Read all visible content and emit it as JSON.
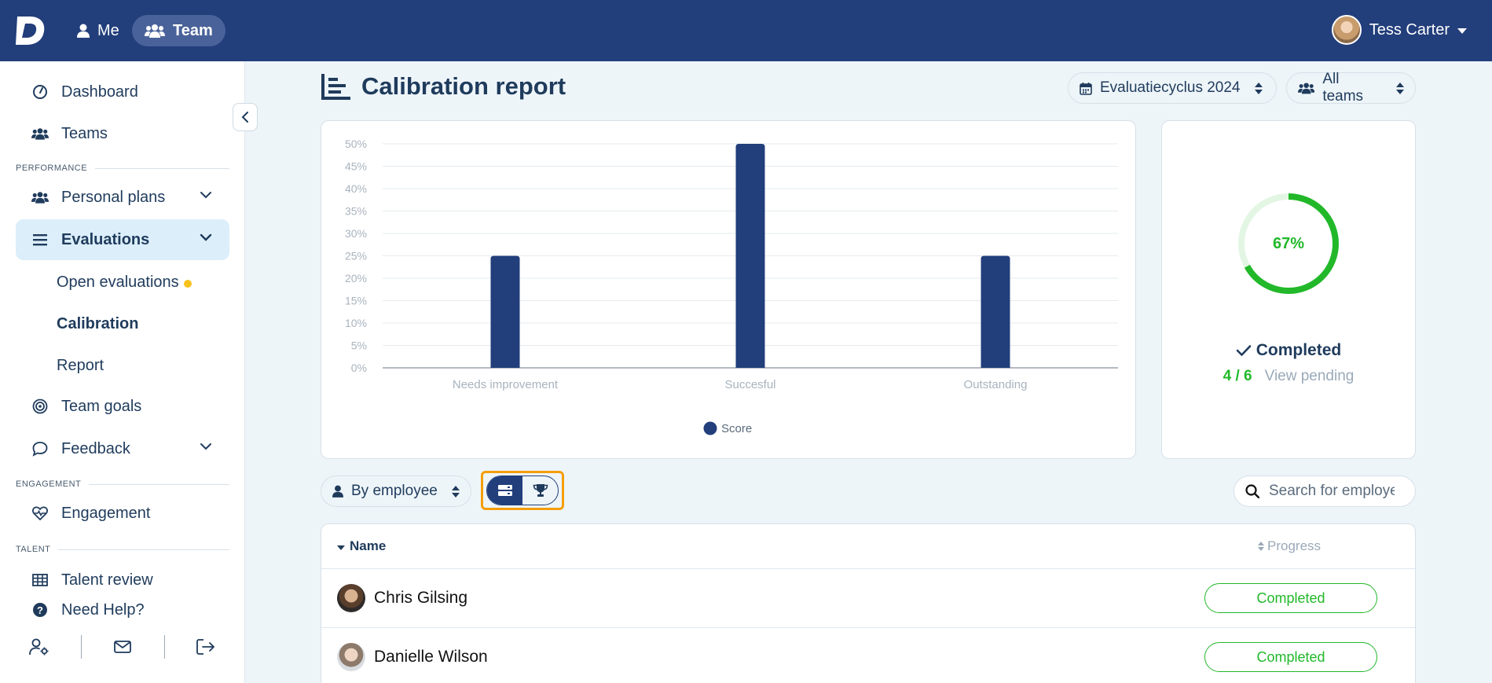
{
  "topbar": {
    "me_label": "Me",
    "team_label": "Team",
    "user_name": "Tess Carter"
  },
  "sidebar": {
    "items": {
      "dashboard": "Dashboard",
      "teams": "Teams",
      "personal_plans": "Personal plans",
      "evaluations": "Evaluations",
      "open_evaluations": "Open evaluations",
      "calibration": "Calibration",
      "report": "Report",
      "team_goals": "Team goals",
      "feedback": "Feedback",
      "engagement": "Engagement",
      "talent_review": "Talent review",
      "need_help": "Need Help?"
    },
    "sections": {
      "performance": "PERFORMANCE",
      "engagement": "ENGAGEMENT",
      "talent": "TALENT"
    }
  },
  "header": {
    "title": "Calibration report",
    "cycle_select": "Evaluatiecyclus 2024",
    "team_select": "All teams"
  },
  "chart_data": {
    "type": "bar",
    "categories": [
      "Needs improvement",
      "Succesful",
      "Outstanding"
    ],
    "series": [
      {
        "name": "Score",
        "values": [
          25,
          50,
          25
        ]
      }
    ],
    "yticks": [
      "0%",
      "5%",
      "10%",
      "15%",
      "20%",
      "25%",
      "30%",
      "35%",
      "40%",
      "45%",
      "50%"
    ],
    "ylim": [
      0,
      50
    ],
    "legend": "bottom",
    "bar_color": "#223e7b"
  },
  "summary": {
    "percent_label": "67%",
    "percent": 67,
    "status_label": "Completed",
    "count_label": "4 / 6",
    "pending_link": "View pending"
  },
  "filters": {
    "group_by": "By employee",
    "search_placeholder": "Search for employee"
  },
  "table": {
    "columns": {
      "name": "Name",
      "progress": "Progress"
    },
    "rows": [
      {
        "name": "Chris Gilsing",
        "status": "Completed"
      },
      {
        "name": "Danielle Wilson",
        "status": "Completed"
      }
    ]
  },
  "colors": {
    "brand": "#223e7b",
    "success": "#22b82a",
    "highlight": "#f59e0b"
  }
}
